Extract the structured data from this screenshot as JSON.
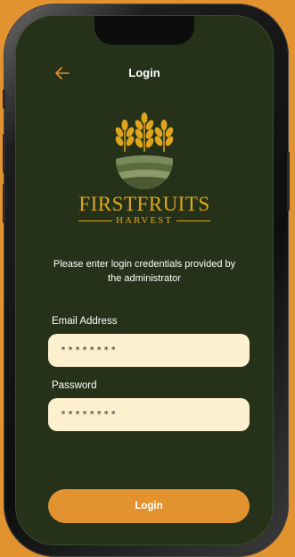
{
  "header": {
    "back_icon": "arrow-left-icon",
    "title": "Login"
  },
  "brand": {
    "name": "FIRSTFRUITS",
    "subtitle": "HARVEST"
  },
  "instructions": "Please enter login credentials provided by the administrator",
  "email": {
    "label": "Email Address",
    "value": "********"
  },
  "password": {
    "label": "Password",
    "value": "********"
  },
  "login_button": {
    "label": "Login"
  },
  "colors": {
    "background": "#e2922f",
    "screen": "#253219",
    "accent": "#e2922f",
    "gold": "#e0a51c",
    "field": "#fdf0cf"
  }
}
